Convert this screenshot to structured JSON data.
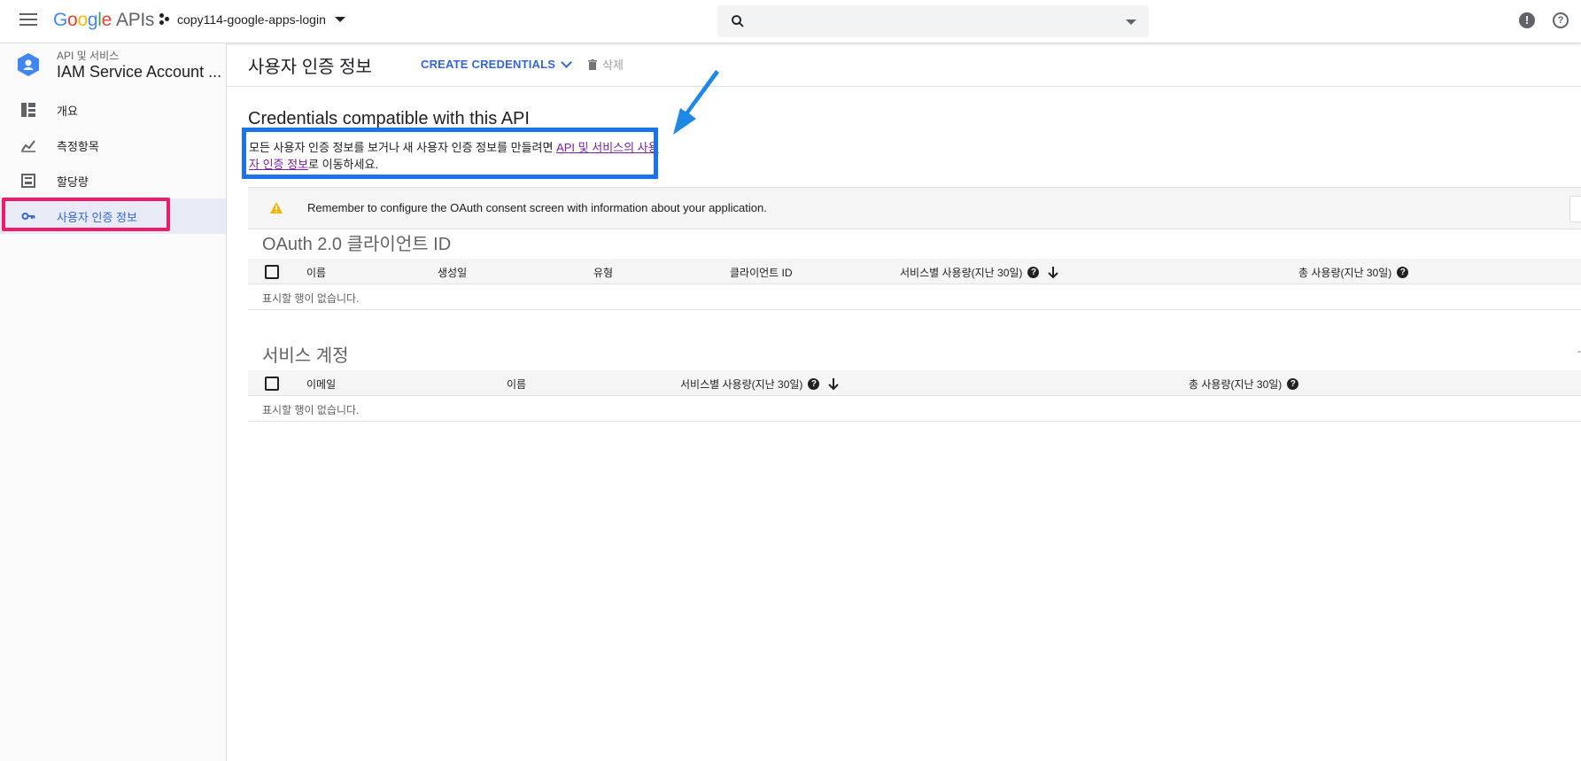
{
  "topbar": {
    "logo_google": "Google",
    "logo_apis": "APIs",
    "project_name": "copy114-google-apps-login",
    "search_placeholder": ""
  },
  "sidebar": {
    "subtitle": "API 및 서비스",
    "title": "IAM Service Account ...",
    "items": [
      {
        "label": "개요",
        "icon": "dashboard-icon"
      },
      {
        "label": "측정항목",
        "icon": "metrics-icon"
      },
      {
        "label": "할당량",
        "icon": "quota-icon"
      },
      {
        "label": "사용자 인증 정보",
        "icon": "key-icon",
        "active": true
      }
    ]
  },
  "toolbar": {
    "page_title": "사용자 인증 정보",
    "create_label": "CREATE CREDENTIALS",
    "delete_label": "삭제"
  },
  "content": {
    "heading": "Credentials compatible with this API",
    "info_prefix": "모든 사용자 인증 정보를 보거나 새 사용자 인증 정보를 만들려면 ",
    "info_link": "API 및 서비스의 사용자 인증 정보",
    "info_suffix": "로 이동하세요.",
    "banner": "Remember to configure the OAuth consent screen with information about your application."
  },
  "oauth": {
    "title": "OAuth 2.0 클라이언트 ID",
    "columns": [
      "이름",
      "생성일",
      "유형",
      "클라이언트 ID",
      "서비스별 사용량(지난 30일)",
      "총 사용량(지난 30일)"
    ],
    "empty": "표시할 행이 없습니다."
  },
  "service_accounts": {
    "title": "서비스 계정",
    "columns": [
      "이메일",
      "이름",
      "서비스별 사용량(지난 30일)",
      "총 사용량(지난 30일)"
    ],
    "empty": "표시할 행이 없습니다."
  },
  "colors": {
    "accent": "#3367d6",
    "highlight_blue": "#1a73e8",
    "highlight_pink": "#ec1c68",
    "warning": "#f4b400"
  }
}
